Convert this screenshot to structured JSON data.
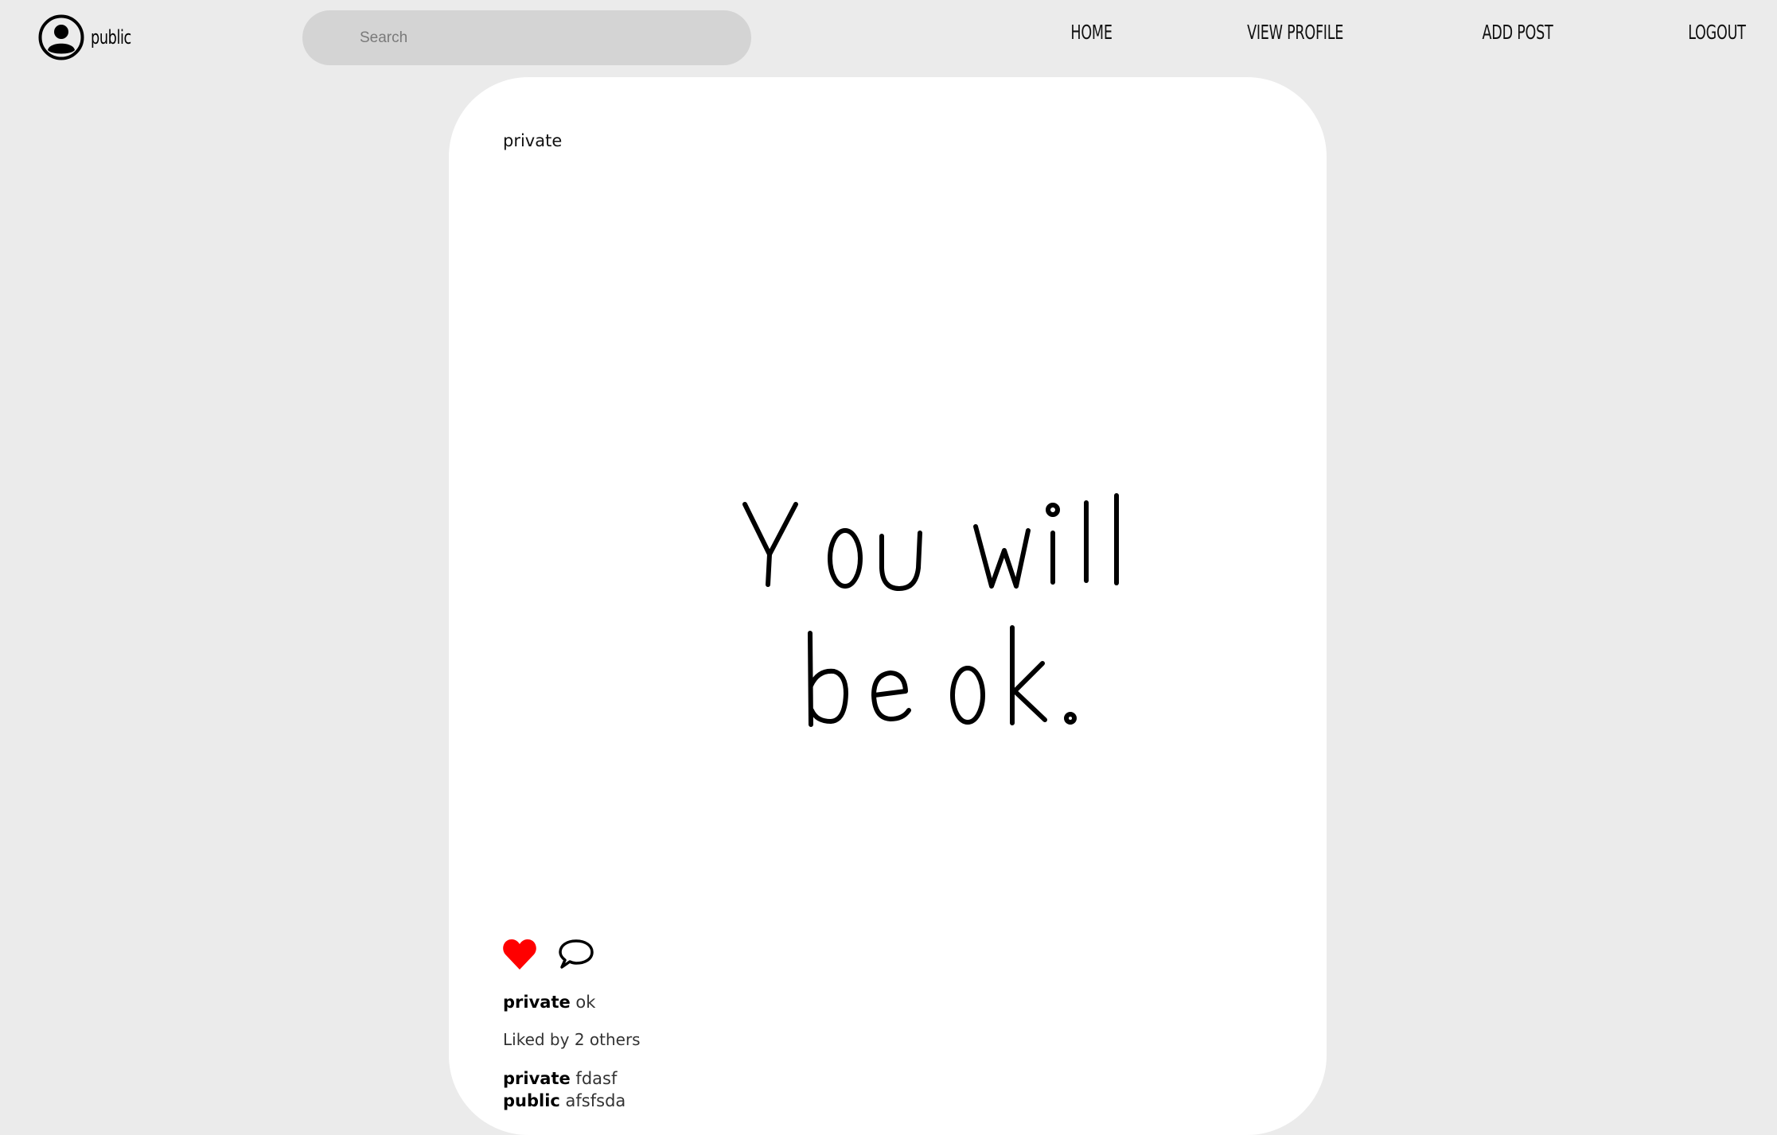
{
  "header": {
    "username": "public",
    "search_placeholder": "Search",
    "nav": {
      "home": "HOME",
      "view_profile": "VIEW PROFILE",
      "add_post": "ADD POST",
      "logout": "LOGOUT"
    }
  },
  "post": {
    "author": "private",
    "image_text_line1": "You will",
    "image_text_line2": "be ok.",
    "liked": true,
    "like_color": "#ff0000",
    "caption": {
      "author": "private",
      "text": "ok"
    },
    "likes_text": "Liked by 2 others",
    "comments": [
      {
        "author": "private",
        "text": "fdasf"
      },
      {
        "author": "public",
        "text": "afsfsda"
      }
    ]
  }
}
